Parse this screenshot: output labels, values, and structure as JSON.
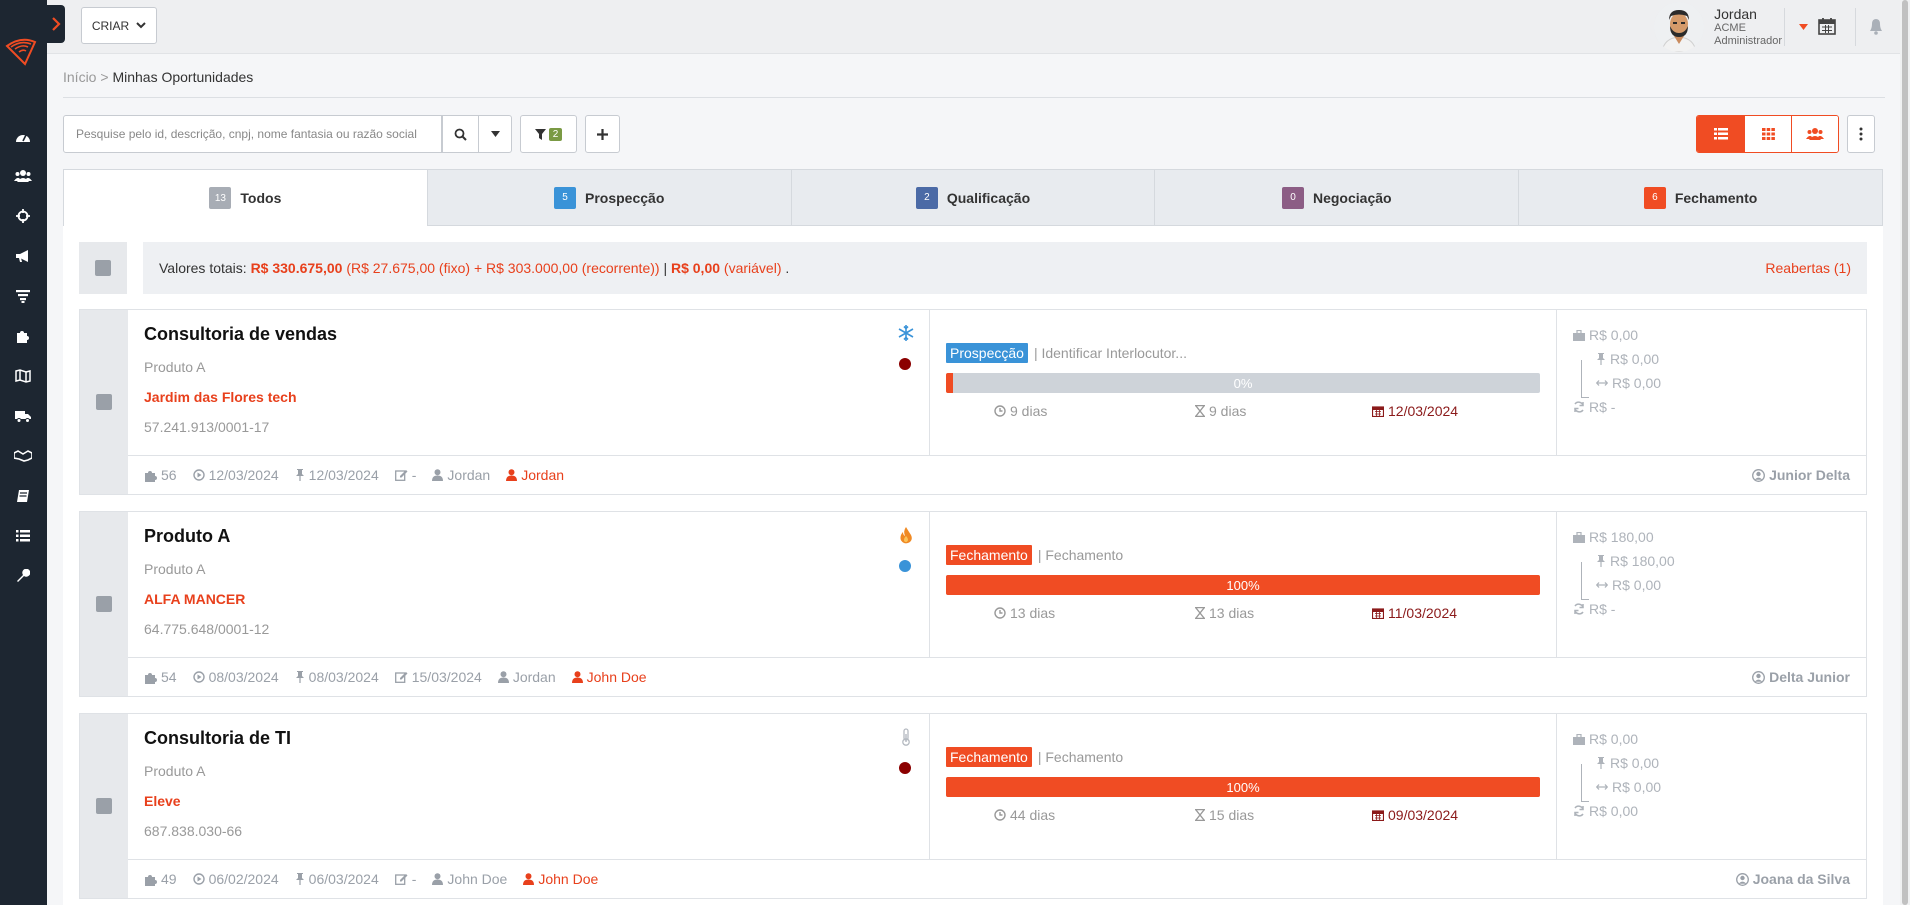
{
  "topbar": {
    "create_label": "CRIAR",
    "user_name": "Jordan",
    "user_company": "ACME",
    "user_role": "Administrador"
  },
  "breadcrumb": {
    "home": "Início",
    "separator": ">",
    "current": "Minhas Oportunidades"
  },
  "search": {
    "placeholder": "Pesquise pelo id, descrição, cnpj, nome fantasia ou razão social",
    "filter_count": "2"
  },
  "tabs": [
    {
      "count": "13",
      "label": "Todos",
      "color": "#a8adb5"
    },
    {
      "count": "5",
      "label": "Prospecção",
      "color": "#3a93d8"
    },
    {
      "count": "2",
      "label": "Qualificação",
      "color": "#4b6aa6"
    },
    {
      "count": "0",
      "label": "Negociação",
      "color": "#8c5d85"
    },
    {
      "count": "6",
      "label": "Fechamento",
      "color": "#f04c23"
    }
  ],
  "totals": {
    "prefix": "Valores totais:",
    "total": "R$ 330.675,00",
    "fixed": "(R$ 27.675,00 (fixo)",
    "plus": "+",
    "recurring": "R$ 303.000,00 (recorrente))",
    "pipe": "|",
    "variable_value": "R$ 0,00",
    "variable_label": "(variável)",
    "dot": ".",
    "reopened": "Reabertas (1)"
  },
  "colors": {
    "accent": "#f04c23",
    "prospeccao": "#3a93d8",
    "fechamento": "#f04c23"
  },
  "opportunities": [
    {
      "title": "Consultoria de vendas",
      "product": "Produto A",
      "company": "Jardim das Flores tech",
      "document": "57.241.913/0001-17",
      "temperature_icon": "snowflake-icon",
      "dot_color": "#8b0000",
      "stage": "Prospecção",
      "stage_color": "#3a93d8",
      "step": "| Identificar Interlocutor...",
      "progress_pct": 0,
      "progress_label": "0%",
      "days_open": "9 dias",
      "days_stage": "9 dias",
      "due_date": "12/03/2024",
      "value_total": "R$ 0,00",
      "value_fixed": "R$ 0,00",
      "value_variable": "R$ 0,00",
      "value_recurring": "R$ -",
      "id": "56",
      "created": "12/03/2024",
      "pinned": "12/03/2024",
      "edited": "-",
      "creator": "Jordan",
      "responsible": "Jordan",
      "contact": "Junior Delta"
    },
    {
      "title": "Produto A",
      "product": "Produto A",
      "company": "ALFA MANCER",
      "document": "64.775.648/0001-12",
      "temperature_icon": "fire-icon",
      "dot_color": "#3a93d8",
      "stage": "Fechamento",
      "stage_color": "#f04c23",
      "step": "| Fechamento",
      "progress_pct": 100,
      "progress_label": "100%",
      "days_open": "13 dias",
      "days_stage": "13 dias",
      "due_date": "11/03/2024",
      "value_total": "R$ 180,00",
      "value_fixed": "R$ 180,00",
      "value_variable": "R$ 0,00",
      "value_recurring": "R$ -",
      "id": "54",
      "created": "08/03/2024",
      "pinned": "08/03/2024",
      "edited": "15/03/2024",
      "creator": "Jordan",
      "responsible": "John Doe",
      "contact": "Delta Junior"
    },
    {
      "title": "Consultoria de TI",
      "product": "Produto A",
      "company": "Eleve",
      "document": "687.838.030-66",
      "temperature_icon": "thermometer-icon",
      "dot_color": "#8b0000",
      "stage": "Fechamento",
      "stage_color": "#f04c23",
      "step": "| Fechamento",
      "progress_pct": 100,
      "progress_label": "100%",
      "days_open": "44 dias",
      "days_stage": "15 dias",
      "due_date": "09/03/2024",
      "value_total": "R$ 0,00",
      "value_fixed": "R$ 0,00",
      "value_variable": "R$ 0,00",
      "value_recurring": "R$ 0,00",
      "id": "49",
      "created": "06/02/2024",
      "pinned": "06/03/2024",
      "edited": "-",
      "creator": "John Doe",
      "responsible": "John Doe",
      "contact": "Joana da Silva"
    }
  ]
}
